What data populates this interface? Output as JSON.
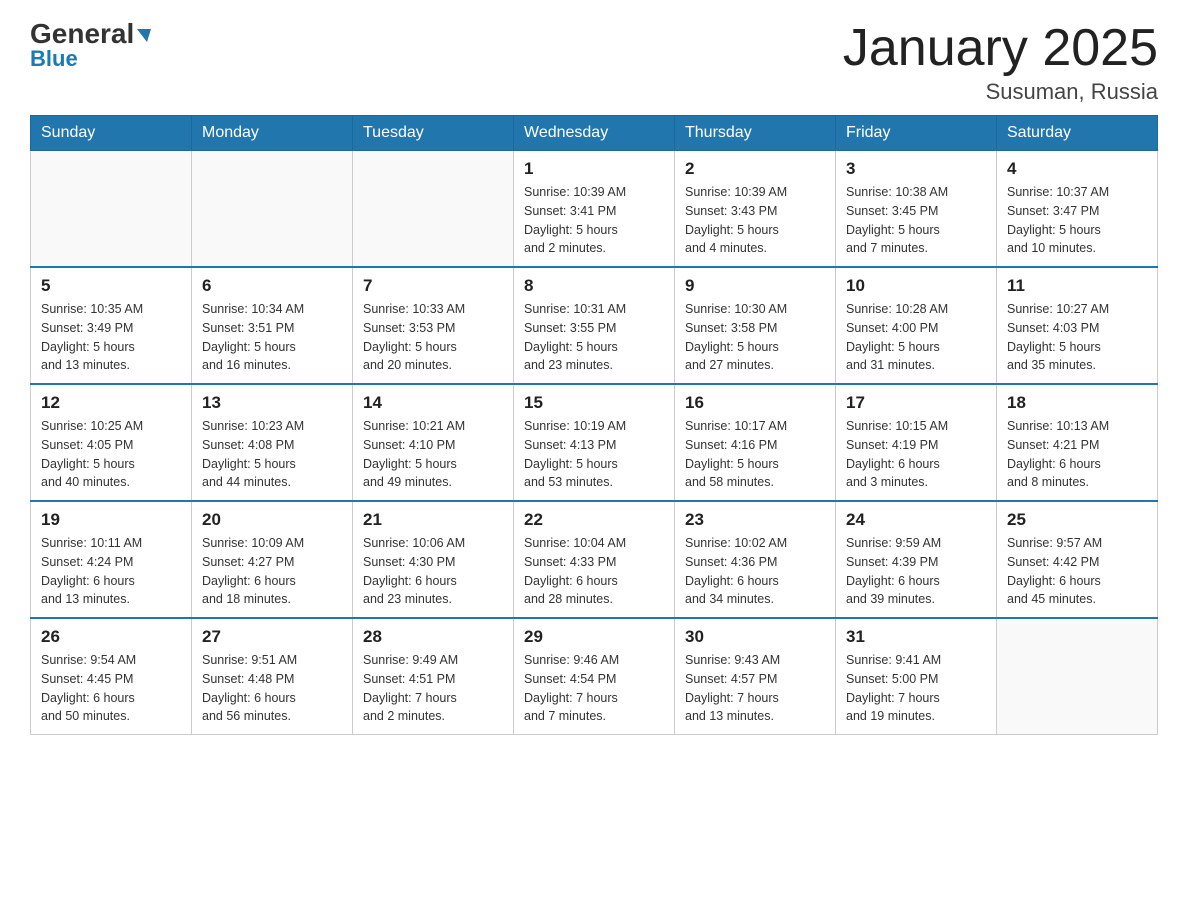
{
  "header": {
    "logo_general": "General",
    "logo_blue": "Blue",
    "title": "January 2025",
    "location": "Susuman, Russia"
  },
  "days_of_week": [
    "Sunday",
    "Monday",
    "Tuesday",
    "Wednesday",
    "Thursday",
    "Friday",
    "Saturday"
  ],
  "weeks": [
    [
      {
        "day": "",
        "info": ""
      },
      {
        "day": "",
        "info": ""
      },
      {
        "day": "",
        "info": ""
      },
      {
        "day": "1",
        "info": "Sunrise: 10:39 AM\nSunset: 3:41 PM\nDaylight: 5 hours\nand 2 minutes."
      },
      {
        "day": "2",
        "info": "Sunrise: 10:39 AM\nSunset: 3:43 PM\nDaylight: 5 hours\nand 4 minutes."
      },
      {
        "day": "3",
        "info": "Sunrise: 10:38 AM\nSunset: 3:45 PM\nDaylight: 5 hours\nand 7 minutes."
      },
      {
        "day": "4",
        "info": "Sunrise: 10:37 AM\nSunset: 3:47 PM\nDaylight: 5 hours\nand 10 minutes."
      }
    ],
    [
      {
        "day": "5",
        "info": "Sunrise: 10:35 AM\nSunset: 3:49 PM\nDaylight: 5 hours\nand 13 minutes."
      },
      {
        "day": "6",
        "info": "Sunrise: 10:34 AM\nSunset: 3:51 PM\nDaylight: 5 hours\nand 16 minutes."
      },
      {
        "day": "7",
        "info": "Sunrise: 10:33 AM\nSunset: 3:53 PM\nDaylight: 5 hours\nand 20 minutes."
      },
      {
        "day": "8",
        "info": "Sunrise: 10:31 AM\nSunset: 3:55 PM\nDaylight: 5 hours\nand 23 minutes."
      },
      {
        "day": "9",
        "info": "Sunrise: 10:30 AM\nSunset: 3:58 PM\nDaylight: 5 hours\nand 27 minutes."
      },
      {
        "day": "10",
        "info": "Sunrise: 10:28 AM\nSunset: 4:00 PM\nDaylight: 5 hours\nand 31 minutes."
      },
      {
        "day": "11",
        "info": "Sunrise: 10:27 AM\nSunset: 4:03 PM\nDaylight: 5 hours\nand 35 minutes."
      }
    ],
    [
      {
        "day": "12",
        "info": "Sunrise: 10:25 AM\nSunset: 4:05 PM\nDaylight: 5 hours\nand 40 minutes."
      },
      {
        "day": "13",
        "info": "Sunrise: 10:23 AM\nSunset: 4:08 PM\nDaylight: 5 hours\nand 44 minutes."
      },
      {
        "day": "14",
        "info": "Sunrise: 10:21 AM\nSunset: 4:10 PM\nDaylight: 5 hours\nand 49 minutes."
      },
      {
        "day": "15",
        "info": "Sunrise: 10:19 AM\nSunset: 4:13 PM\nDaylight: 5 hours\nand 53 minutes."
      },
      {
        "day": "16",
        "info": "Sunrise: 10:17 AM\nSunset: 4:16 PM\nDaylight: 5 hours\nand 58 minutes."
      },
      {
        "day": "17",
        "info": "Sunrise: 10:15 AM\nSunset: 4:19 PM\nDaylight: 6 hours\nand 3 minutes."
      },
      {
        "day": "18",
        "info": "Sunrise: 10:13 AM\nSunset: 4:21 PM\nDaylight: 6 hours\nand 8 minutes."
      }
    ],
    [
      {
        "day": "19",
        "info": "Sunrise: 10:11 AM\nSunset: 4:24 PM\nDaylight: 6 hours\nand 13 minutes."
      },
      {
        "day": "20",
        "info": "Sunrise: 10:09 AM\nSunset: 4:27 PM\nDaylight: 6 hours\nand 18 minutes."
      },
      {
        "day": "21",
        "info": "Sunrise: 10:06 AM\nSunset: 4:30 PM\nDaylight: 6 hours\nand 23 minutes."
      },
      {
        "day": "22",
        "info": "Sunrise: 10:04 AM\nSunset: 4:33 PM\nDaylight: 6 hours\nand 28 minutes."
      },
      {
        "day": "23",
        "info": "Sunrise: 10:02 AM\nSunset: 4:36 PM\nDaylight: 6 hours\nand 34 minutes."
      },
      {
        "day": "24",
        "info": "Sunrise: 9:59 AM\nSunset: 4:39 PM\nDaylight: 6 hours\nand 39 minutes."
      },
      {
        "day": "25",
        "info": "Sunrise: 9:57 AM\nSunset: 4:42 PM\nDaylight: 6 hours\nand 45 minutes."
      }
    ],
    [
      {
        "day": "26",
        "info": "Sunrise: 9:54 AM\nSunset: 4:45 PM\nDaylight: 6 hours\nand 50 minutes."
      },
      {
        "day": "27",
        "info": "Sunrise: 9:51 AM\nSunset: 4:48 PM\nDaylight: 6 hours\nand 56 minutes."
      },
      {
        "day": "28",
        "info": "Sunrise: 9:49 AM\nSunset: 4:51 PM\nDaylight: 7 hours\nand 2 minutes."
      },
      {
        "day": "29",
        "info": "Sunrise: 9:46 AM\nSunset: 4:54 PM\nDaylight: 7 hours\nand 7 minutes."
      },
      {
        "day": "30",
        "info": "Sunrise: 9:43 AM\nSunset: 4:57 PM\nDaylight: 7 hours\nand 13 minutes."
      },
      {
        "day": "31",
        "info": "Sunrise: 9:41 AM\nSunset: 5:00 PM\nDaylight: 7 hours\nand 19 minutes."
      },
      {
        "day": "",
        "info": ""
      }
    ]
  ]
}
